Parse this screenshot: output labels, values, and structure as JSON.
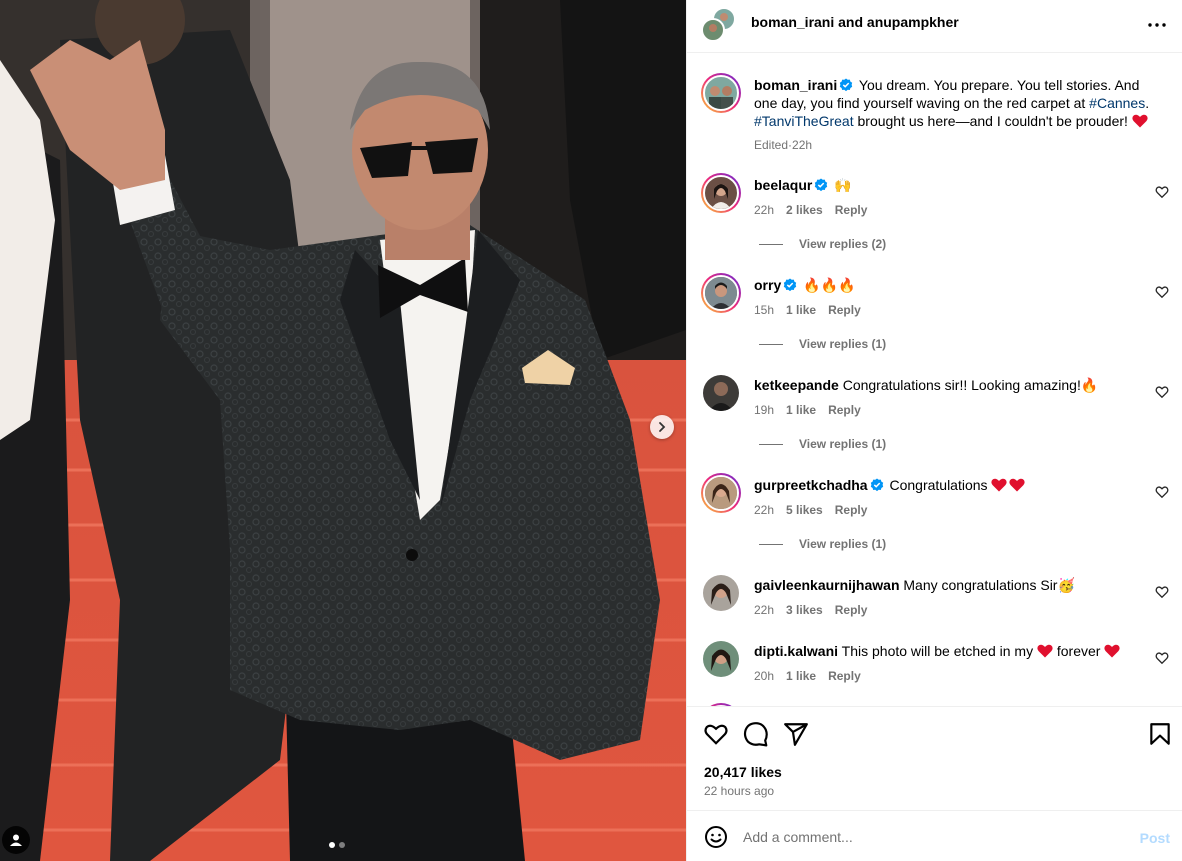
{
  "header": {
    "author1": "boman_irani",
    "and": "and",
    "author2": "anupampkher"
  },
  "caption": {
    "username": "boman_irani",
    "text_part1": " You dream. You prepare. You tell stories. And one day, you find yourself waving on the red carpet at ",
    "hashtag1": "#Cannes",
    "text_part2": ". ",
    "hashtag2": "#TanviTheGreat",
    "text_part3": " brought us here—and I couldn't be prouder! ",
    "edited": "Edited",
    "dot": " · ",
    "time": "22h"
  },
  "comments": [
    {
      "username": "beelaqur",
      "verified": true,
      "text": " 🙌",
      "time": "22h",
      "likes": "2 likes",
      "reply": "Reply",
      "view_replies": "View replies (2)",
      "avatar_color": "#6b4f45"
    },
    {
      "username": "orry",
      "verified": true,
      "text": " 🔥🔥🔥",
      "time": "15h",
      "likes": "1 like",
      "reply": "Reply",
      "view_replies": "View replies (1)",
      "avatar_color": "#5a5a5a"
    },
    {
      "username": "ketkeepande",
      "verified": false,
      "text": " Congratulations sir!! Looking amazing!🔥",
      "time": "19h",
      "likes": "1 like",
      "reply": "Reply",
      "view_replies": "View replies (1)",
      "avatar_color": "#3d3b38"
    },
    {
      "username": "gurpreetkchadha",
      "verified": true,
      "text": " Congratulations ",
      "time": "22h",
      "likes": "5 likes",
      "reply": "Reply",
      "view_replies": "View replies (1)",
      "avatar_color": "#8a6a52"
    },
    {
      "username": "gaivleenkaurnijhawan",
      "verified": false,
      "text": " Many congratulations Sir🥳",
      "time": "22h",
      "likes": "3 likes",
      "reply": "Reply",
      "avatar_color": "#5c5248"
    },
    {
      "username": "dipti.kalwani",
      "verified": false,
      "text_part1": " This photo will be etched in my ",
      "text_part2": " forever ",
      "time": "20h",
      "likes": "1 like",
      "reply": "Reply",
      "avatar_color": "#4a6a5a"
    }
  ],
  "actions": {
    "likes": "20,417 likes",
    "time_ago": "22 hours ago"
  },
  "add_comment": {
    "placeholder": "Add a comment...",
    "post_label": "Post"
  },
  "colors": {
    "verified": "#0095f6",
    "heart_red": "#ff3040",
    "link": "#00376b",
    "secondary": "#737373"
  }
}
